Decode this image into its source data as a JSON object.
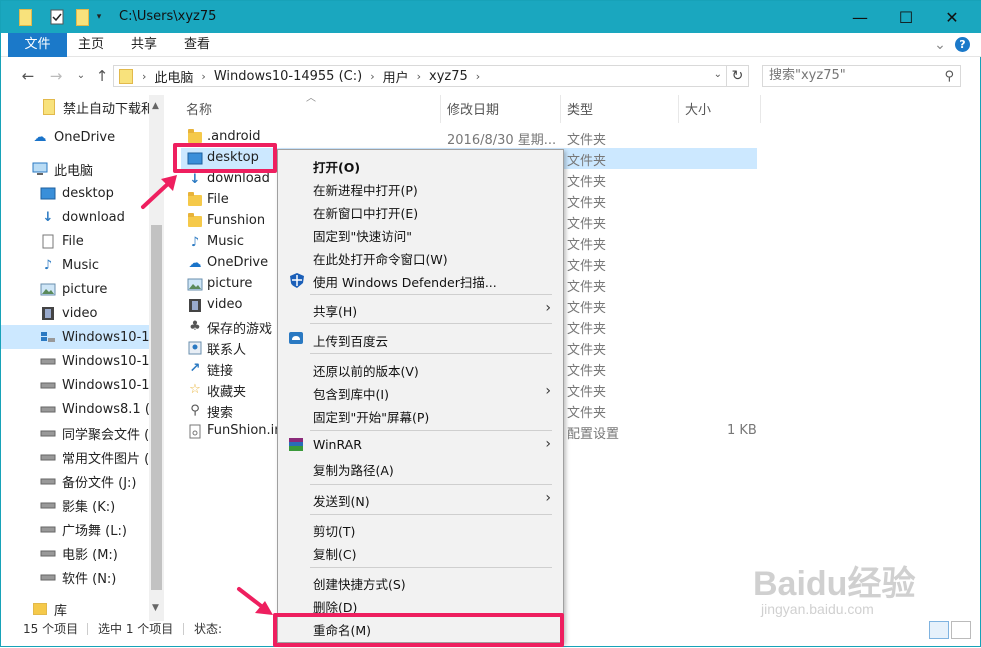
{
  "titlebar": {
    "path": "C:\\Users\\xyz75",
    "minimize": "—",
    "maximize": "☐",
    "close": "✕"
  },
  "ribbon": {
    "tabs": [
      "文件",
      "主页",
      "共享",
      "查看"
    ],
    "help": "?",
    "expand": "⌄"
  },
  "addressbar": {
    "crumbs": [
      "此电脑",
      "Windows10-14955 (C:)",
      "用户",
      "xyz75"
    ],
    "search_placeholder": "搜索\"xyz75\""
  },
  "navpane": {
    "items": [
      {
        "label": "禁止自动下载和",
        "icon": "folder-icon"
      },
      {
        "label": "OneDrive",
        "icon": "onedrive-icon"
      },
      {
        "label": "此电脑",
        "icon": "computer-icon"
      },
      {
        "label": "desktop",
        "icon": "desktop-icon"
      },
      {
        "label": "download",
        "icon": "download-icon"
      },
      {
        "label": "File",
        "icon": "file-icon"
      },
      {
        "label": "Music",
        "icon": "music-icon"
      },
      {
        "label": "picture",
        "icon": "picture-icon"
      },
      {
        "label": "video",
        "icon": "video-icon"
      },
      {
        "label": "Windows10-14",
        "icon": "drive-icon"
      },
      {
        "label": "Windows10-14",
        "icon": "drive-icon"
      },
      {
        "label": "Windows10-14",
        "icon": "drive-icon"
      },
      {
        "label": "Windows8.1 (F:",
        "icon": "drive-icon"
      },
      {
        "label": "同学聚会文件 (I",
        "icon": "drive-icon"
      },
      {
        "label": "常用文件图片 (I:",
        "icon": "drive-icon"
      },
      {
        "label": "备份文件 (J:)",
        "icon": "drive-icon"
      },
      {
        "label": "影集 (K:)",
        "icon": "drive-icon"
      },
      {
        "label": "广场舞 (L:)",
        "icon": "drive-icon"
      },
      {
        "label": "电影 (M:)",
        "icon": "drive-icon"
      },
      {
        "label": "软件 (N:)",
        "icon": "drive-icon"
      },
      {
        "label": "库",
        "icon": "library-icon"
      }
    ]
  },
  "columns": {
    "name": "名称",
    "date": "修改日期",
    "type": "类型",
    "size": "大小"
  },
  "files": [
    {
      "name": ".android",
      "date": "2016/8/30 星期...",
      "type": "文件夹",
      "size": ""
    },
    {
      "name": "desktop",
      "date": "",
      "type": "文件夹",
      "size": ""
    },
    {
      "name": "download",
      "date": "",
      "type": "文件夹",
      "size": ""
    },
    {
      "name": "File",
      "date": "",
      "type": "文件夹",
      "size": ""
    },
    {
      "name": "Funshion",
      "date": "",
      "type": "文件夹",
      "size": ""
    },
    {
      "name": "Music",
      "date": "",
      "type": "文件夹",
      "size": ""
    },
    {
      "name": "OneDrive",
      "date": "",
      "type": "文件夹",
      "size": ""
    },
    {
      "name": "picture",
      "date": "",
      "type": "文件夹",
      "size": ""
    },
    {
      "name": "video",
      "date": "",
      "type": "文件夹",
      "size": ""
    },
    {
      "name": "保存的游戏",
      "date": "",
      "type": "文件夹",
      "size": ""
    },
    {
      "name": "联系人",
      "date": "",
      "type": "文件夹",
      "size": ""
    },
    {
      "name": "链接",
      "date": "",
      "type": "文件夹",
      "size": ""
    },
    {
      "name": "收藏夹",
      "date": "",
      "type": "文件夹",
      "size": ""
    },
    {
      "name": "搜索",
      "date": "",
      "type": "文件夹",
      "size": ""
    },
    {
      "name": "FunShion.ini",
      "date": "",
      "type": "配置设置",
      "size": "1 KB"
    }
  ],
  "contextmenu": {
    "items": [
      {
        "label": "打开(O)",
        "bold": true
      },
      {
        "label": "在新进程中打开(P)"
      },
      {
        "label": "在新窗口中打开(E)"
      },
      {
        "label": "固定到\"快速访问\""
      },
      {
        "label": "在此处打开命令窗口(W)"
      },
      {
        "label": "使用 Windows Defender扫描..."
      },
      {
        "label": "共享(H)"
      },
      {
        "label": "上传到百度云"
      },
      {
        "label": "还原以前的版本(V)"
      },
      {
        "label": "包含到库中(I)"
      },
      {
        "label": "固定到\"开始\"屏幕(P)"
      },
      {
        "label": "WinRAR"
      },
      {
        "label": "复制为路径(A)"
      },
      {
        "label": "发送到(N)"
      },
      {
        "label": "剪切(T)"
      },
      {
        "label": "复制(C)"
      },
      {
        "label": "创建快捷方式(S)"
      },
      {
        "label": "删除(D)"
      },
      {
        "label": "重命名(M)"
      }
    ]
  },
  "status": {
    "count": "15 个项目",
    "selected": "选中 1 个项目",
    "state": "状态:"
  },
  "watermark": {
    "brand": "Baidu经验",
    "url": "jingyan.baidu.com"
  },
  "colors": {
    "titlebar": "#1aa7bf",
    "file_tab": "#1b79c9",
    "highlight": "#ee1f5f",
    "selection": "#cce8ff"
  }
}
